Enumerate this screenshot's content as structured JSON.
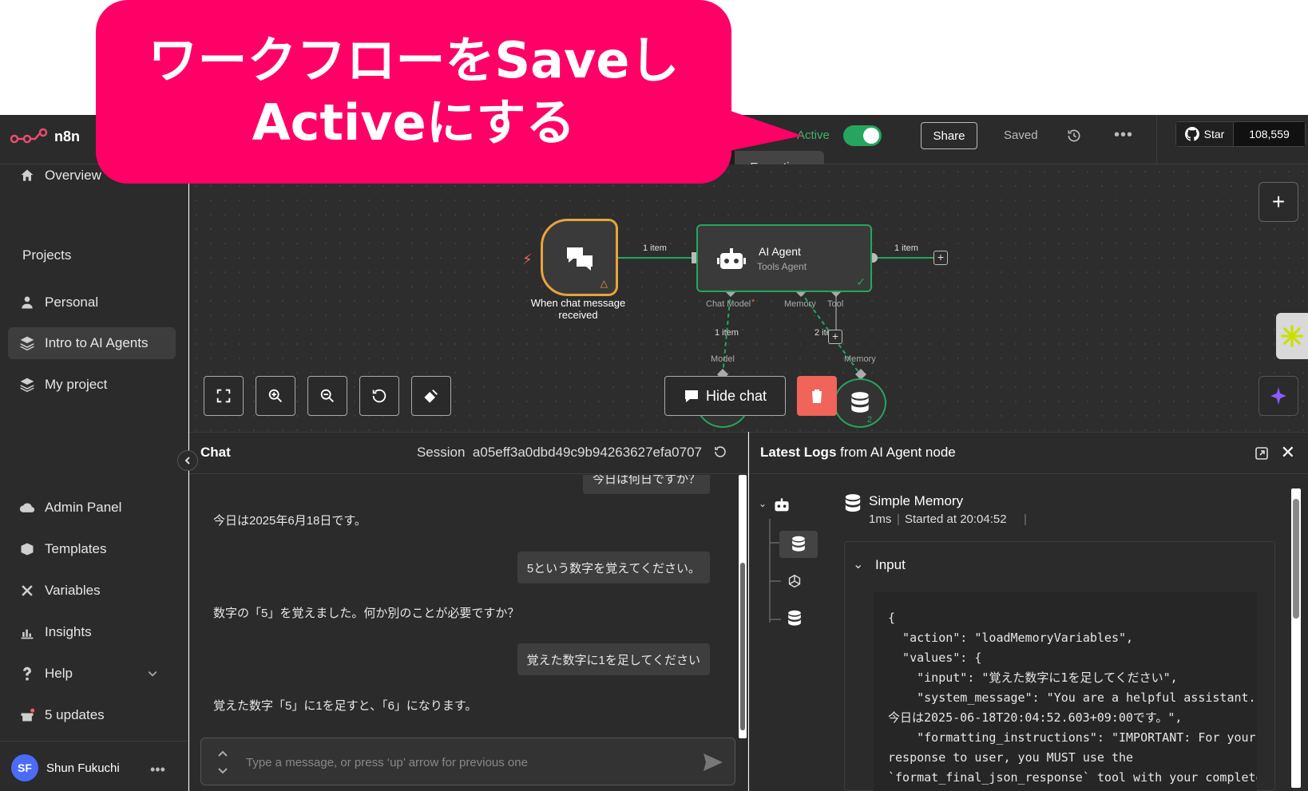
{
  "callout": {
    "line1": "ワークフローをSaveし",
    "line2": "Activeにする"
  },
  "app": {
    "name": "n8n"
  },
  "header": {
    "active_label": "Active",
    "share_label": "Share",
    "saved_label": "Saved",
    "more_label": "•••",
    "github_star_label": "Star",
    "github_star_count": "108,559"
  },
  "tabs": {
    "executions": "Executions"
  },
  "sidebar": {
    "overview": "Overview",
    "projects_label": "Projects",
    "items": [
      {
        "label": "Personal"
      },
      {
        "label": "Intro to AI Agents"
      },
      {
        "label": "My project"
      }
    ],
    "bottom": [
      {
        "label": "Admin Panel"
      },
      {
        "label": "Templates"
      },
      {
        "label": "Variables"
      },
      {
        "label": "Insights"
      },
      {
        "label": "Help"
      },
      {
        "label": "5 updates"
      }
    ],
    "user_initials": "SF",
    "user_name": "Shun Fukuchi"
  },
  "canvas": {
    "trigger_label_1": "When chat message",
    "trigger_label_2": "received",
    "edge1_label": "1 item",
    "edge2_label": "1 item",
    "agent_title": "AI Agent",
    "agent_subtitle": "Tools Agent",
    "port_chat_model": "Chat Model",
    "port_memory": "Memory",
    "port_tool": "Tool",
    "model_edge_label": "1 item",
    "memory_edge_label": "2 items",
    "model_port_label": "Model",
    "memory_port_label": "Memory",
    "memory_count": "2",
    "hide_chat_label": "Hide chat"
  },
  "chat": {
    "title": "Chat",
    "session_label": "Session",
    "session_id": "a05eff3a0dbd49c9b94263627efa0707",
    "messages": [
      {
        "role": "user",
        "text": "今日は何日ですか？"
      },
      {
        "role": "bot",
        "text": "今日は2025年6月18日です。"
      },
      {
        "role": "user",
        "text": "5という数字を覚えてください。"
      },
      {
        "role": "bot",
        "text": "数字の「5」を覚えました。何か別のことが必要ですか？"
      },
      {
        "role": "user",
        "text": "覚えた数字に1を足してください"
      },
      {
        "role": "bot",
        "text": "覚えた数字「5」に1を足すと、「6」になります。"
      }
    ],
    "input_placeholder": "Type a message, or press ‘up’ arrow for previous one"
  },
  "logs": {
    "title_bold": "Latest Logs",
    "title_rest": " from AI Agent node",
    "node_name": "Simple Memory",
    "duration": "1ms",
    "started": "Started at 20:04:52",
    "input_label": "Input",
    "json_text": "{\n  \"action\": \"loadMemoryVariables\",\n  \"values\": {\n    \"input\": \"覚えた数字に1を足してください\",\n    \"system_message\": \"You are a helpful assistant.\n今日は2025-06-18T20:04:52.603+09:00です。\",\n    \"formatting_instructions\": \"IMPORTANT: For your\nresponse to user, you MUST use the\n`format_final_json_response` tool with your complete"
  },
  "colors": {
    "accent": "#ff0066",
    "active": "#25a55f",
    "node_border": "#25a55f",
    "trigger_border": "#e8a33d",
    "trash": "#f0645a"
  }
}
